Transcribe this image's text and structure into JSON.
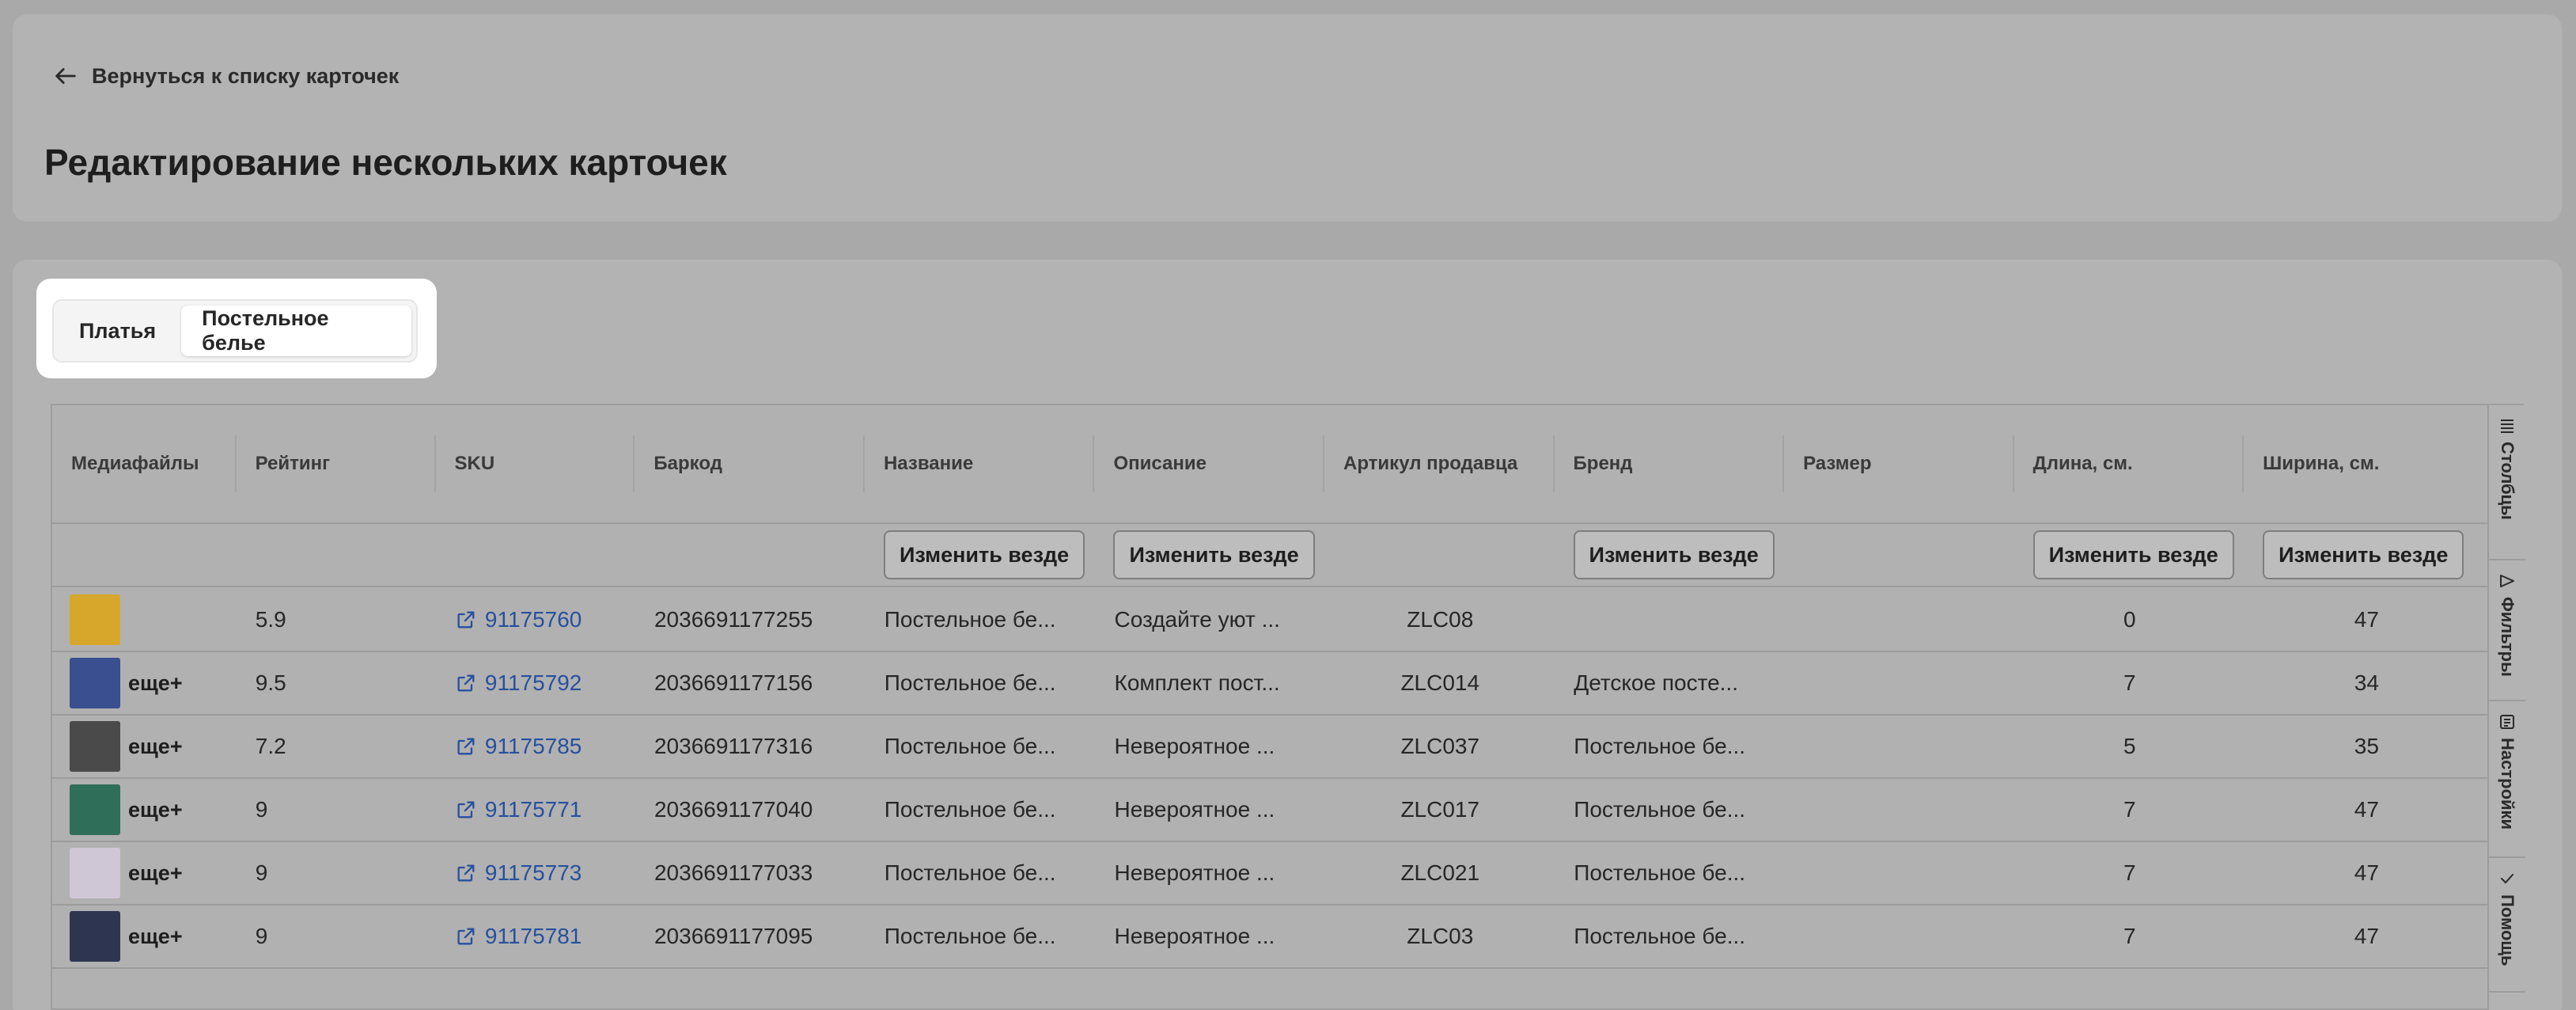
{
  "header": {
    "back_label": "Вернуться к списку карточек",
    "title": "Редактирование нескольких карточек"
  },
  "tabs": [
    {
      "label": "Платья",
      "active": false
    },
    {
      "label": "Постельное белье",
      "active": true
    }
  ],
  "table": {
    "columns": [
      "Медиафайлы",
      "Рейтинг",
      "SKU",
      "Баркод",
      "Название",
      "Описание",
      "Артикул продавца",
      "Бренд",
      "Размер",
      "Длина, см.",
      "Ширина, см."
    ],
    "bulk_edit_label": "Изменить везде",
    "more_label": "еще+",
    "rows": [
      {
        "rating": "5.9",
        "sku": "91175760",
        "barcode": "2036691177255",
        "name": "Постельное бе...",
        "description": "Создайте уют ...",
        "article": "ZLC08",
        "brand": "",
        "size": "",
        "length": "0",
        "width": "47",
        "has_more": false,
        "thumb_color": "#d6a72a"
      },
      {
        "rating": "9.5",
        "sku": "91175792",
        "barcode": "2036691177156",
        "name": "Постельное бе...",
        "description": "Комплект пост...",
        "article": "ZLC014",
        "brand": "Детское посте...",
        "size": "",
        "length": "7",
        "width": "34",
        "has_more": true,
        "thumb_color": "#3a4f8f"
      },
      {
        "rating": "7.2",
        "sku": "91175785",
        "barcode": "2036691177316",
        "name": "Постельное бе...",
        "description": "Невероятное ...",
        "article": "ZLC037",
        "brand": "Постельное бе...",
        "size": "",
        "length": "5",
        "width": "35",
        "has_more": true,
        "thumb_color": "#4a4a4a"
      },
      {
        "rating": "9",
        "sku": "91175771",
        "barcode": "2036691177040",
        "name": "Постельное бе...",
        "description": "Невероятное ...",
        "article": "ZLC017",
        "brand": "Постельное бе...",
        "size": "",
        "length": "7",
        "width": "47",
        "has_more": true,
        "thumb_color": "#2f6f5a"
      },
      {
        "rating": "9",
        "sku": "91175773",
        "barcode": "2036691177033",
        "name": "Постельное бе...",
        "description": "Невероятное ...",
        "article": "ZLC021",
        "brand": "Постельное бе...",
        "size": "",
        "length": "7",
        "width": "47",
        "has_more": true,
        "thumb_color": "#cfc7d6"
      },
      {
        "rating": "9",
        "sku": "91175781",
        "barcode": "2036691177095",
        "name": "Постельное бе...",
        "description": "Невероятное ...",
        "article": "ZLC03",
        "brand": "Постельное бе...",
        "size": "",
        "length": "7",
        "width": "47",
        "has_more": true,
        "thumb_color": "#2e3550"
      }
    ]
  },
  "side_toolbar": [
    "Столбцы",
    "Фильтры",
    "Настройки",
    "Помощь"
  ],
  "colors": {
    "link": "#27509e",
    "backdrop": "#a9a9a9",
    "panel": "#b3b3b3"
  }
}
